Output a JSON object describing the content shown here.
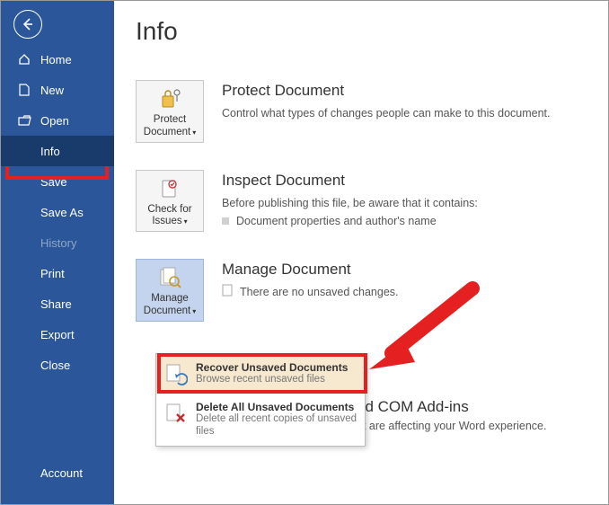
{
  "page": {
    "title": "Info"
  },
  "sidebar": {
    "back_label": "Back",
    "items": [
      {
        "label": "Home"
      },
      {
        "label": "New"
      },
      {
        "label": "Open"
      },
      {
        "label": "Info"
      },
      {
        "label": "Save"
      },
      {
        "label": "Save As"
      },
      {
        "label": "History"
      },
      {
        "label": "Print"
      },
      {
        "label": "Share"
      },
      {
        "label": "Export"
      },
      {
        "label": "Close"
      }
    ],
    "account_label": "Account"
  },
  "sections": {
    "protect": {
      "tile_label": "Protect Document",
      "title": "Protect Document",
      "desc": "Control what types of changes people can make to this document."
    },
    "inspect": {
      "tile_label": "Check for Issues",
      "title": "Inspect Document",
      "desc": "Before publishing this file, be aware that it contains:",
      "bullet": "Document properties and author's name"
    },
    "manage": {
      "tile_label": "Manage Document",
      "title": "Manage Document",
      "desc": "There are no unsaved changes."
    },
    "addins": {
      "title_tail": "ed COM Add-ins",
      "desc_tail": "at are affecting your Word experience."
    }
  },
  "dropdown": {
    "recover": {
      "title": "Recover Unsaved Documents",
      "sub": "Browse recent unsaved files"
    },
    "delete": {
      "title": "Delete All Unsaved Documents",
      "sub": "Delete all recent copies of unsaved files"
    }
  }
}
